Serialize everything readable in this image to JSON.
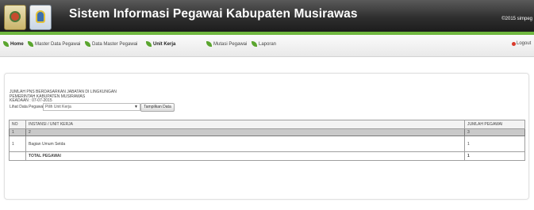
{
  "header": {
    "title": "Sistem Informasi Pegawai Kabupaten Musirawas",
    "copyright": "©2015 simpeg",
    "logo_left_icon": "regency-emblem-icon",
    "logo_right_icon": "government-crest-icon"
  },
  "colors": {
    "accent": "#6fb73f",
    "header": "#2f2f2f"
  },
  "nav": {
    "home": "Home",
    "master_data_pegawai": "Master Data Pegawai",
    "data_master_pegawai": "Data Master Pegawai",
    "unit_kerja": "Unit Kerja",
    "mutasi_pegawai": "Mutasi Pegawai",
    "laporan": "Laporan",
    "logout": "Logout"
  },
  "report": {
    "line1": "JUMLAH PNS BERDASARKAN JABATAN DI LINGKUNGAN",
    "line2": "PEMERINTAH KABUPATEN MUSIRAWAS",
    "line3": "KEADAAN : 07-07-2015"
  },
  "filter": {
    "label": "Lihat Data Pegawai",
    "select_value": "Pilih Unit Kerja",
    "button": "Tampilkan Data"
  },
  "table": {
    "headers": [
      "NO",
      "INSTANSI / UNIT KERJA",
      "JUMLAH PEGAWAI"
    ],
    "numbering": [
      "1",
      "2",
      "3"
    ],
    "rows": [
      {
        "no": "1",
        "unit": "Bagian Umum Setda",
        "jumlah": "1"
      }
    ],
    "total_label": "TOTAL PEGAWAI",
    "total_value": "1"
  }
}
